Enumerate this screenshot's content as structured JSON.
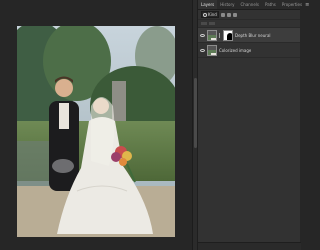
{
  "layers_panel": {
    "tabs": [
      {
        "label": "Layers"
      },
      {
        "label": "History"
      },
      {
        "label": "Channels"
      },
      {
        "label": "Paths"
      },
      {
        "label": "Properties"
      }
    ],
    "filter_label": "Kind",
    "layers": [
      {
        "name": "Depth Blur neural",
        "active": true
      },
      {
        "name": "Colorized image",
        "active": false
      }
    ]
  }
}
